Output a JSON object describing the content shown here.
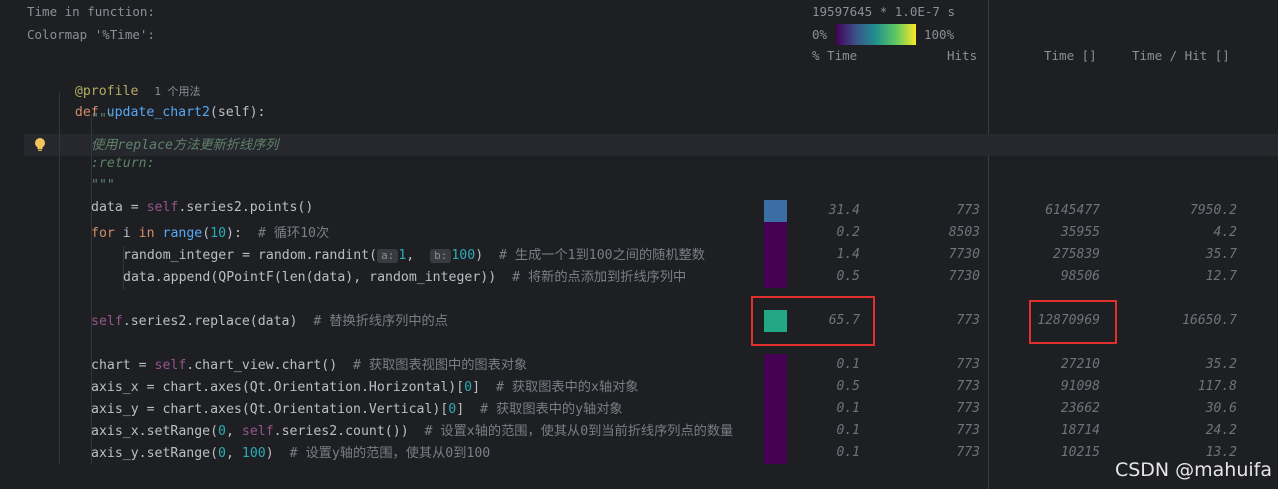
{
  "profiler_header": {
    "time_label": "Time in function:",
    "time_value": "19597645 * 1.0E-7 s",
    "colormap_label": "Colormap '%Time':",
    "colormap_min": "0%",
    "colormap_max": "100%",
    "col_pct_time": "% Time",
    "col_hits": "Hits",
    "col_time": "Time []",
    "col_time_per_hit": "Time / Hit []"
  },
  "code": {
    "decorator": "@profile",
    "decorator_usage": "1 个用法",
    "def_kw": "def",
    "func_name": "update_chart2",
    "func_params": "(self):",
    "doc_open": "\"\"\"",
    "doc_line1": "使用replace方法更新折线序列",
    "doc_return": ":return:",
    "doc_close": "\"\"\""
  },
  "rows": [
    {
      "pre": "data = ",
      "self": "self",
      "post": ".series2.points()",
      "comment": "",
      "pct": "31.4",
      "hits": "773",
      "time": "6145477",
      "per_hit": "7950.2",
      "color": "#3b6fa3"
    },
    {
      "pre": "for i in range(10):",
      "self": "",
      "post": "",
      "comment": "# 循环10次",
      "pct": "0.2",
      "hits": "8503",
      "time": "35955",
      "per_hit": "4.2",
      "color": "#440154"
    },
    {
      "pre": "random_integer = random.randint(",
      "self": "",
      "post": "",
      "comment": "# 生成一个1到100之间的随机整数",
      "pct": "1.4",
      "hits": "7730",
      "time": "275839",
      "per_hit": "35.7",
      "color": "#440154"
    },
    {
      "pre": "data.append(QPointF(len(data), random_integer))",
      "self": "",
      "post": "",
      "comment": "# 将新的点添加到折线序列中",
      "pct": "0.5",
      "hits": "7730",
      "time": "98506",
      "per_hit": "12.7",
      "color": "#440154"
    },
    {
      "pre": "",
      "self": "self",
      "post": ".series2.replace(data)",
      "comment": "# 替换折线序列中的点",
      "pct": "65.7",
      "hits": "773",
      "time": "12870969",
      "per_hit": "16650.7",
      "color": "#22a884"
    },
    {
      "pre": "chart = ",
      "self": "self",
      "post": ".chart_view.chart()",
      "comment": "# 获取图表视图中的图表对象",
      "pct": "0.1",
      "hits": "773",
      "time": "27210",
      "per_hit": "35.2",
      "color": "#440154"
    },
    {
      "pre": "axis_x = chart.axes(Qt.Orientation.Horizontal)[",
      "self": "",
      "post": "]",
      "comment": "# 获取图表中的x轴对象",
      "pct": "0.5",
      "hits": "773",
      "time": "91098",
      "per_hit": "117.8",
      "color": "#440154"
    },
    {
      "pre": "axis_y = chart.axes(Qt.Orientation.Vertical)[",
      "self": "",
      "post": "]",
      "comment": "# 获取图表中的y轴对象",
      "pct": "0.1",
      "hits": "773",
      "time": "23662",
      "per_hit": "30.6",
      "color": "#440154"
    },
    {
      "pre": "axis_x.setRange(",
      "self": "self",
      "post": ".series2.count())",
      "comment": "# 设置x轴的范围，使其从0到当前折线序列点的数量",
      "pct": "0.1",
      "hits": "773",
      "time": "18714",
      "per_hit": "24.2",
      "color": "#440154"
    },
    {
      "pre": "axis_y.setRange(",
      "self": "",
      "post": ")",
      "comment": "# 设置y轴的范围，使其从0到100",
      "pct": "0.1",
      "hits": "773",
      "time": "10215",
      "per_hit": "13.2",
      "color": "#440154"
    }
  ],
  "randint_hints": {
    "a_label": "a:",
    "a_value": "1",
    "b_label": "b:",
    "b_value": "100"
  },
  "literals": {
    "ten": "10",
    "zero": "0",
    "hundred": "100"
  },
  "watermark": "CSDN @mahuifa",
  "colors": {
    "background": "#1e1f22",
    "highlight": "#e0312e",
    "viridis_low": "#440154",
    "viridis_high": "#fde725"
  }
}
